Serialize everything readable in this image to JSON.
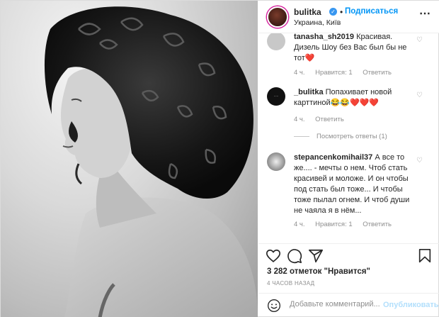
{
  "header": {
    "username": "bulitka",
    "separator": "•",
    "follow_label": "Подписаться",
    "location": "Украина, Київ",
    "more_icon": "more-horizontal-icon"
  },
  "comments": [
    {
      "username": "tanasha_sh2019",
      "text": "Красивая. Дизель Шоу без Вас был бы не тот❤️",
      "time": "4 ч.",
      "likes": "Нравится: 1",
      "reply": "Ответить"
    },
    {
      "username": "_bulitka",
      "text": "Попахивает новой карттиной😂😂❤️❤️❤️",
      "time": "4 ч.",
      "reply": "Ответить",
      "view_replies": "Посмотреть ответы (1)"
    },
    {
      "username": "stepancenkomihail37",
      "text": "А все то же.... - мечты о нем. Чтоб стать красивей и моложе. И он чтобы под стать был тоже... И чтобы тоже пылал огнем. И чтоб души не чаяла я в нём...",
      "time": "4 ч.",
      "likes": "Нравится: 1",
      "reply": "Ответить"
    }
  ],
  "footer": {
    "likes_text": "3 282 отметок \"Нравится\"",
    "time_ago": "4 ЧАСОВ НАЗАД",
    "comment_placeholder": "Добавьте комментарий...",
    "publish_label": "Опубликовать"
  },
  "colors": {
    "accent": "#0095f6",
    "muted": "#8e8e8e",
    "heart": "#ed4956"
  }
}
